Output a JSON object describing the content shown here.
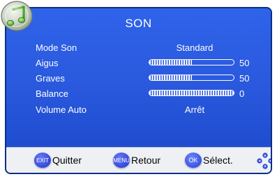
{
  "menu": {
    "title": "SON",
    "items": [
      {
        "label": "Mode Son",
        "value": "Standard"
      },
      {
        "label": "Aigus",
        "level": 50,
        "number": "50"
      },
      {
        "label": "Graves",
        "level": 50,
        "number": "50"
      },
      {
        "label": "Balance",
        "level": 100,
        "number": "0"
      },
      {
        "label": "Volume Auto",
        "value": "Arrêt"
      }
    ]
  },
  "footer": {
    "exit": {
      "key": "EXIT",
      "label": "Quitter"
    },
    "menu": {
      "key": "MENU",
      "label": "Retour"
    },
    "ok": {
      "key": "OK",
      "label": "Sélect."
    }
  },
  "icons": {
    "logo": "music-note-icon",
    "nav": "dpad-arrows-icon"
  },
  "colors": {
    "panel": "#2a59dd",
    "footer": "#eef0f4",
    "button": "#3a4fe0",
    "text": "#ffffff"
  }
}
